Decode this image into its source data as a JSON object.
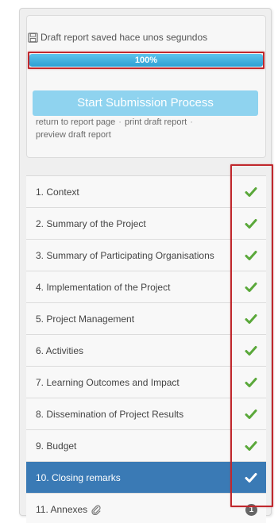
{
  "status": {
    "saved_text": "Draft report saved hace unos segundos",
    "progress_percent": 100,
    "progress_label": "100%",
    "submit_label": "Start Submission Process",
    "links": [
      {
        "label": "return to report page"
      },
      {
        "label": "print draft report"
      },
      {
        "label": "preview draft report"
      }
    ],
    "separator": "·"
  },
  "menu": {
    "items": [
      {
        "label": "1. Context",
        "status": "complete",
        "icon": "check-icon"
      },
      {
        "label": "2. Summary of the Project",
        "status": "complete",
        "icon": "check-icon"
      },
      {
        "label": "3. Summary of Participating Organisations",
        "status": "complete",
        "icon": "check-icon"
      },
      {
        "label": "4. Implementation of the Project",
        "status": "complete",
        "icon": "check-icon"
      },
      {
        "label": "5. Project Management",
        "status": "complete",
        "icon": "check-icon"
      },
      {
        "label": "6. Activities",
        "status": "complete",
        "icon": "check-icon"
      },
      {
        "label": "7. Learning Outcomes and Impact",
        "status": "complete",
        "icon": "check-icon"
      },
      {
        "label": "8. Dissemination of Project Results",
        "status": "complete",
        "icon": "check-icon"
      },
      {
        "label": "9. Budget",
        "status": "complete",
        "icon": "check-icon"
      },
      {
        "label": "10. Closing remarks",
        "status": "complete",
        "active": true,
        "icon": "check-icon"
      },
      {
        "label": "11. Annexes",
        "attachment_icon": "paperclip-icon",
        "badge": "1"
      }
    ]
  },
  "colors": {
    "check_green": "#5aa83a",
    "active_bg": "#3a7ab5",
    "highlight_red": "#c0282d",
    "progress_blue": "#2e9fd3",
    "button_blue": "#8fd3ef"
  }
}
